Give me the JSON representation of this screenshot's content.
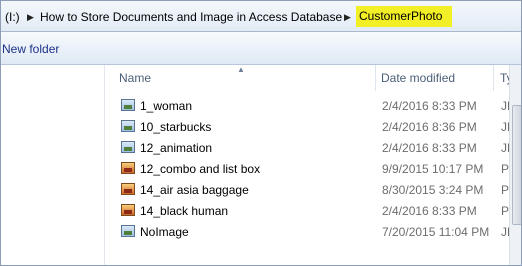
{
  "address": {
    "drive": "(I:)",
    "folder": "How to Store Documents and Image in Access Database",
    "current": "CustomerPhoto"
  },
  "toolbar": {
    "new_folder_label": "New folder"
  },
  "columns": {
    "name": "Name",
    "date": "Date modified",
    "type": "Typ"
  },
  "files": [
    {
      "name": "1_woman",
      "date": "2/4/2016 8:33 PM",
      "type": "JPEG",
      "icon": "jpeg-image-icon"
    },
    {
      "name": "10_starbucks",
      "date": "2/4/2016 8:36 PM",
      "type": "JPEG",
      "icon": "jpeg-image-icon"
    },
    {
      "name": "12_animation",
      "date": "2/4/2016 8:33 PM",
      "type": "JPEG",
      "icon": "jpeg-image-icon"
    },
    {
      "name": "12_combo and list box",
      "date": "9/9/2015 10:17 PM",
      "type": "PNG",
      "icon": "png-image-icon"
    },
    {
      "name": "14_air asia baggage",
      "date": "8/30/2015 3:24 PM",
      "type": "PNG",
      "icon": "png-image-icon"
    },
    {
      "name": "14_black human",
      "date": "2/4/2016 8:33 PM",
      "type": "PNG",
      "icon": "png-image-icon"
    },
    {
      "name": "NoImage",
      "date": "7/20/2015 11:04 PM",
      "type": "JPEG",
      "icon": "jpeg-image-icon"
    }
  ],
  "colors": {
    "highlight": "#f2ef27",
    "link": "#1e3287"
  }
}
